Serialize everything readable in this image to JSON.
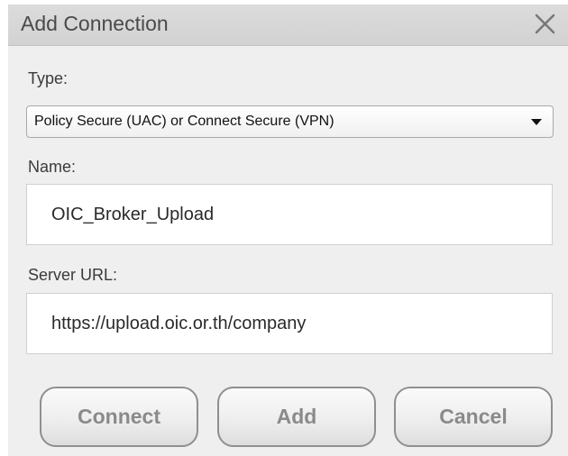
{
  "dialog": {
    "title": "Add Connection",
    "close_icon": "close-icon"
  },
  "type_field": {
    "label": "Type:",
    "selected": "Policy Secure (UAC) or Connect Secure (VPN)"
  },
  "name_field": {
    "label": "Name:",
    "value": "OIC_Broker_Upload"
  },
  "server_field": {
    "label": "Server URL:",
    "value": "https://upload.oic.or.th/company"
  },
  "buttons": {
    "connect": "Connect",
    "add": "Add",
    "cancel": "Cancel"
  },
  "colors": {
    "dialog_bg": "#efefef",
    "titlebar_bg": "#d6d6d6",
    "button_text": "#8a8a8a"
  }
}
